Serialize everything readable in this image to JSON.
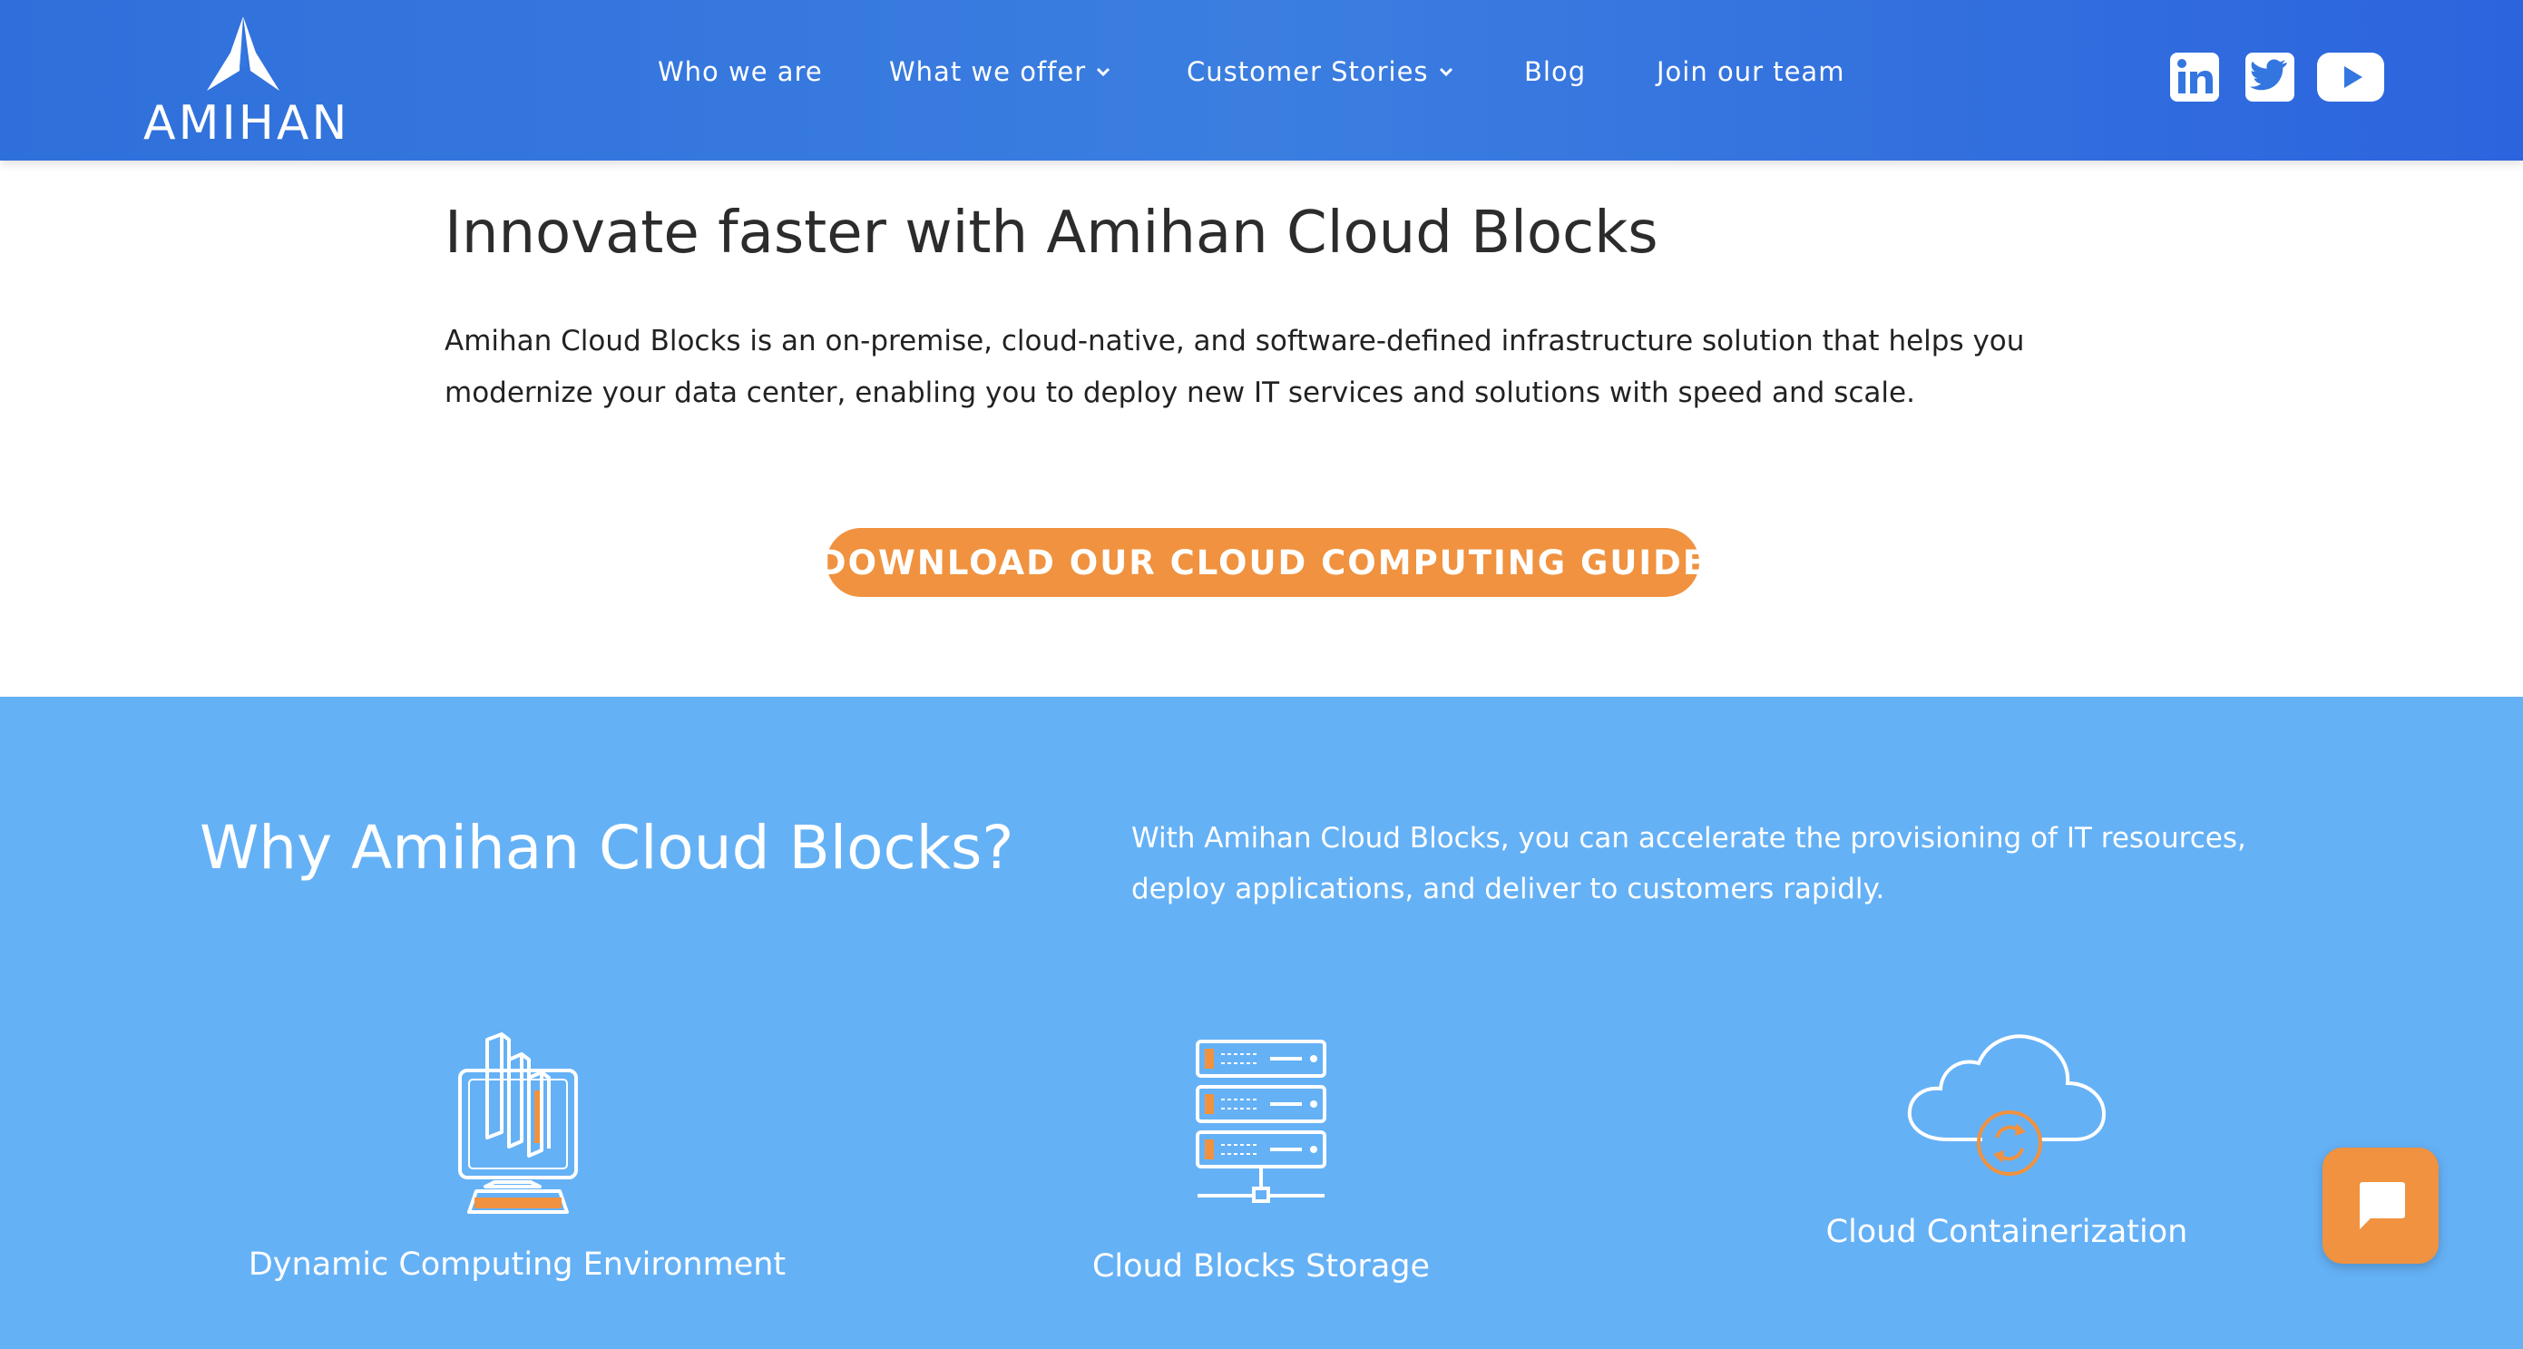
{
  "header": {
    "logo_text": "AMIHAN",
    "nav": [
      {
        "label": "Who we are",
        "has_dropdown": false
      },
      {
        "label": "What we offer",
        "has_dropdown": true
      },
      {
        "label": "Customer Stories",
        "has_dropdown": true
      },
      {
        "label": "Blog",
        "has_dropdown": false
      },
      {
        "label": "Join our team",
        "has_dropdown": false
      }
    ],
    "social": [
      "linkedin-icon",
      "twitter-icon",
      "youtube-icon"
    ]
  },
  "hero": {
    "title": "Innovate faster with Amihan Cloud Blocks",
    "description": "Amihan Cloud Blocks is an on-premise, cloud-native, and software-defined infrastructure solution that helps you modernize your data center, enabling you to deploy new IT services and solutions with speed and scale.",
    "cta_label": "DOWNLOAD OUR CLOUD COMPUTING GUIDE"
  },
  "why": {
    "title": "Why Amihan Cloud Blocks?",
    "description": "With Amihan Cloud Blocks, you can accelerate the provisioning of IT resources, deploy applications, and deliver to customers rapidly.",
    "features": [
      {
        "label": "Dynamic Computing Environment",
        "icon": "computer-blocks-icon"
      },
      {
        "label": "Cloud Blocks Storage",
        "icon": "server-storage-icon"
      },
      {
        "label": "Cloud Containerization",
        "icon": "cloud-sync-icon"
      }
    ]
  },
  "chat": {
    "icon": "chat-icon"
  },
  "colors": {
    "header_blue": "#3476e0",
    "accent_orange": "#f0923f",
    "section_blue": "#65b1f6",
    "text_dark": "#2c2c2c",
    "white": "#ffffff"
  }
}
